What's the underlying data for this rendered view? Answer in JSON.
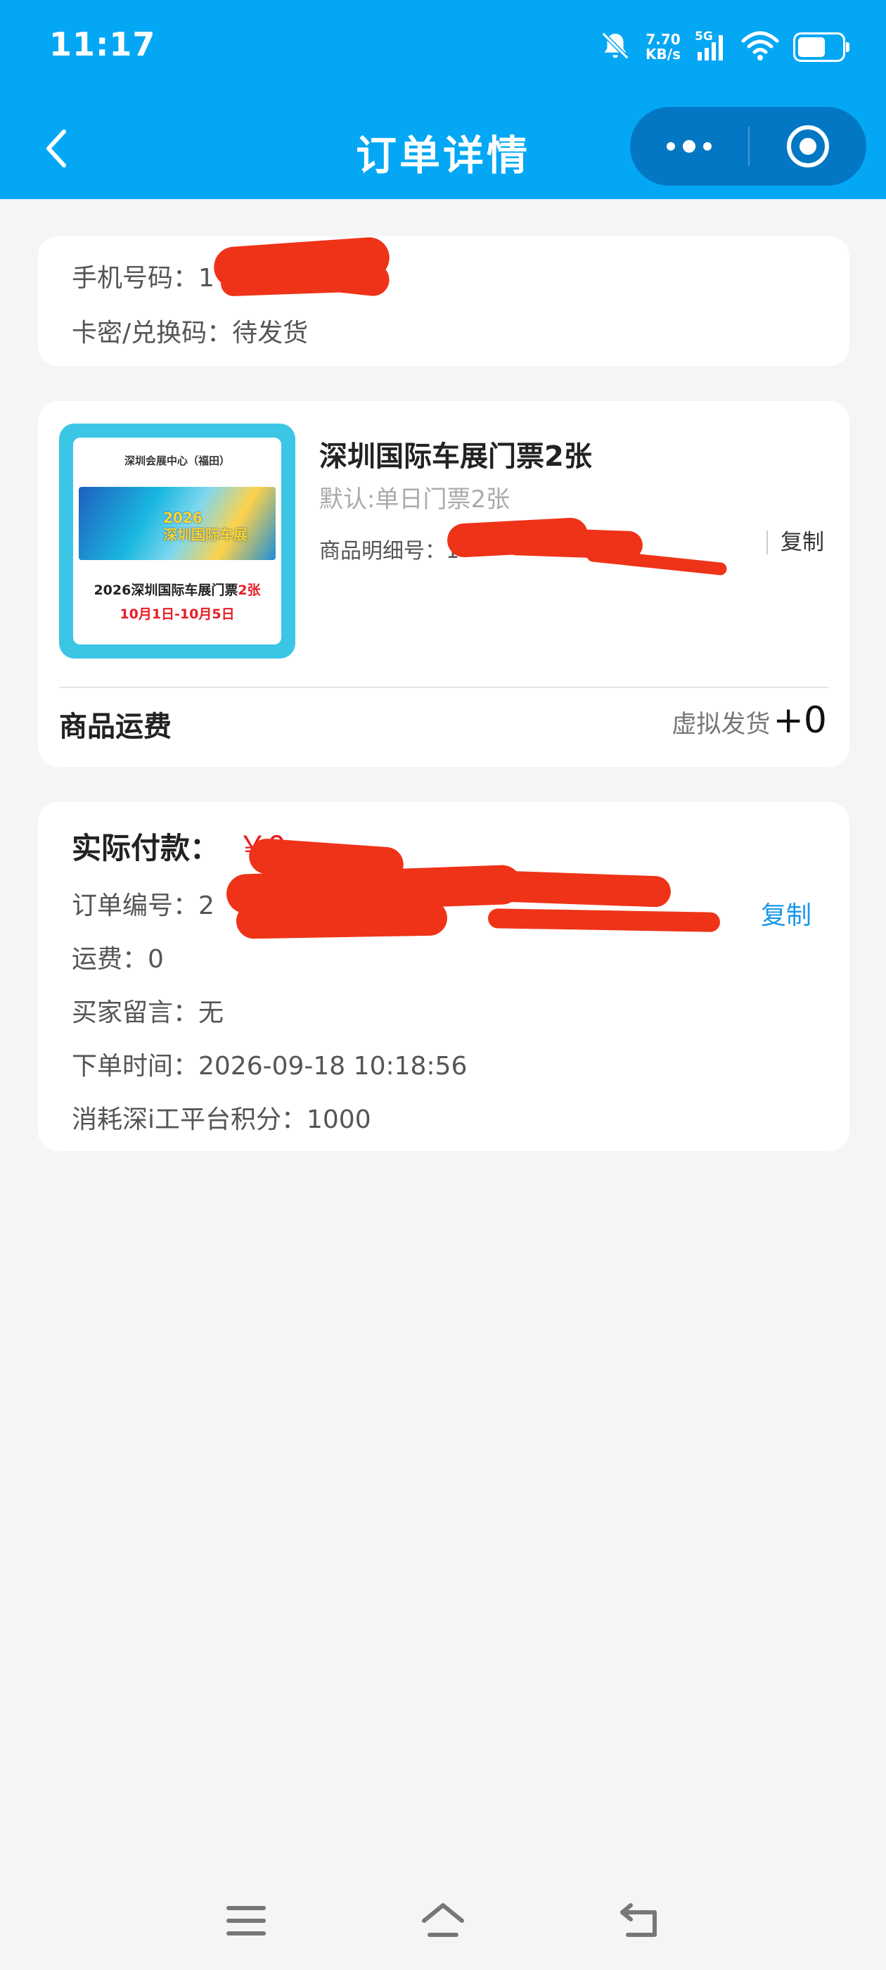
{
  "status_bar": {
    "time": "11:17",
    "net_speed_value": "7.70",
    "net_speed_unit": "KB/s",
    "network_type": "5G",
    "icons": [
      "bell-off-icon",
      "signal-icon",
      "wifi-icon",
      "battery-icon"
    ]
  },
  "nav": {
    "title": "订单详情",
    "back_icon": "chevron-left-icon",
    "more_icon": "more-icon",
    "close_icon": "target-close-icon"
  },
  "contact": {
    "phone_label": "手机号码：",
    "phone_value_visible": "1",
    "code_label": "卡密/兑换码：",
    "code_value": "待发货"
  },
  "product": {
    "image": {
      "venue": "深圳会展中心（福田）",
      "banner_year": "2026",
      "banner_text": "深圳国际车展",
      "caption_prefix": "2026深圳国际车展门票",
      "caption_highlight": "2张",
      "dates": "10月1日-10月5日"
    },
    "title": "深圳国际车展门票2张",
    "spec": "默认:单日门票2张",
    "detail_label": "商品明细号：",
    "detail_value_visible": "1",
    "copy_label": "复制",
    "shipping_label": "商品运费",
    "shipping_method": "虚拟发货",
    "shipping_amount": "+0"
  },
  "payment": {
    "paid_label": "实际付款：",
    "paid_amount": "￥0",
    "order_no_label": "订单编号：",
    "order_no_visible": "2",
    "copy_label": "复制",
    "freight": "运费：0",
    "buyer_note": "买家留言：无",
    "order_time": "下单时间：2026-09-18 10:18:56",
    "points": "消耗深i工平台积分：1000"
  },
  "system_nav": {
    "icons": [
      "menu-icon",
      "home-icon",
      "back-icon"
    ]
  },
  "colors": {
    "header_blue": "#04a7f4",
    "capsule_blue": "#0377c4",
    "price_red": "#e81e25",
    "link_blue": "#1a98e6",
    "redaction_red": "#ee3318"
  }
}
